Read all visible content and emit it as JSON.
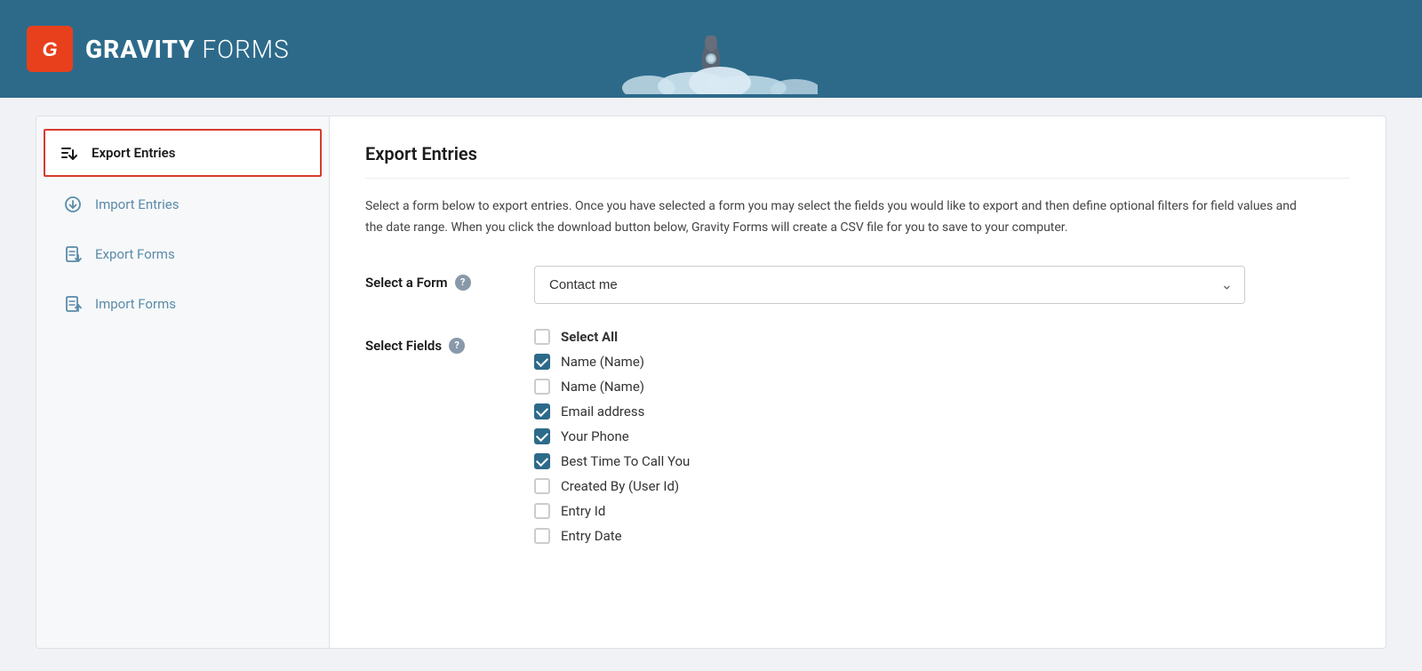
{
  "header": {
    "logo_letter": "G",
    "logo_bold": "GRAVITY",
    "logo_light": " FORMS"
  },
  "sidebar": {
    "items": [
      {
        "id": "export-entries",
        "label": "Export Entries",
        "icon": "export-entries-icon",
        "active": true
      },
      {
        "id": "import-entries",
        "label": "Import Entries",
        "icon": "import-entries-icon",
        "active": false
      },
      {
        "id": "export-forms",
        "label": "Export Forms",
        "icon": "export-forms-icon",
        "active": false
      },
      {
        "id": "import-forms",
        "label": "Import Forms",
        "icon": "import-forms-icon",
        "active": false
      }
    ]
  },
  "main": {
    "page_title": "Export Entries",
    "description": "Select a form below to export entries. Once you have selected a form you may select the fields you would like to export and then define optional filters for field values and the date range. When you click the download button below, Gravity Forms will create a CSV file for you to save to your computer.",
    "select_form_label": "Select a Form",
    "select_form_value": "Contact me",
    "select_fields_label": "Select Fields",
    "help_tooltip": "?",
    "fields": [
      {
        "id": "select-all",
        "label": "Select All",
        "checked": false,
        "bold": true
      },
      {
        "id": "name-1",
        "label": "Name (Name)",
        "checked": true,
        "bold": false
      },
      {
        "id": "name-2",
        "label": "Name (Name)",
        "checked": false,
        "bold": false
      },
      {
        "id": "email-address",
        "label": "Email address",
        "checked": true,
        "bold": false
      },
      {
        "id": "your-phone",
        "label": "Your Phone",
        "checked": true,
        "bold": false
      },
      {
        "id": "best-time",
        "label": "Best Time To Call You",
        "checked": true,
        "bold": false
      },
      {
        "id": "created-by",
        "label": "Created By (User Id)",
        "checked": false,
        "bold": false
      },
      {
        "id": "entry-id",
        "label": "Entry Id",
        "checked": false,
        "bold": false
      },
      {
        "id": "entry-date",
        "label": "Entry Date",
        "checked": false,
        "bold": false
      }
    ]
  },
  "colors": {
    "header_bg": "#2d6a8a",
    "logo_orange": "#e8401c",
    "active_border": "#d63c2f",
    "checkbox_checked": "#2d6a8a"
  }
}
